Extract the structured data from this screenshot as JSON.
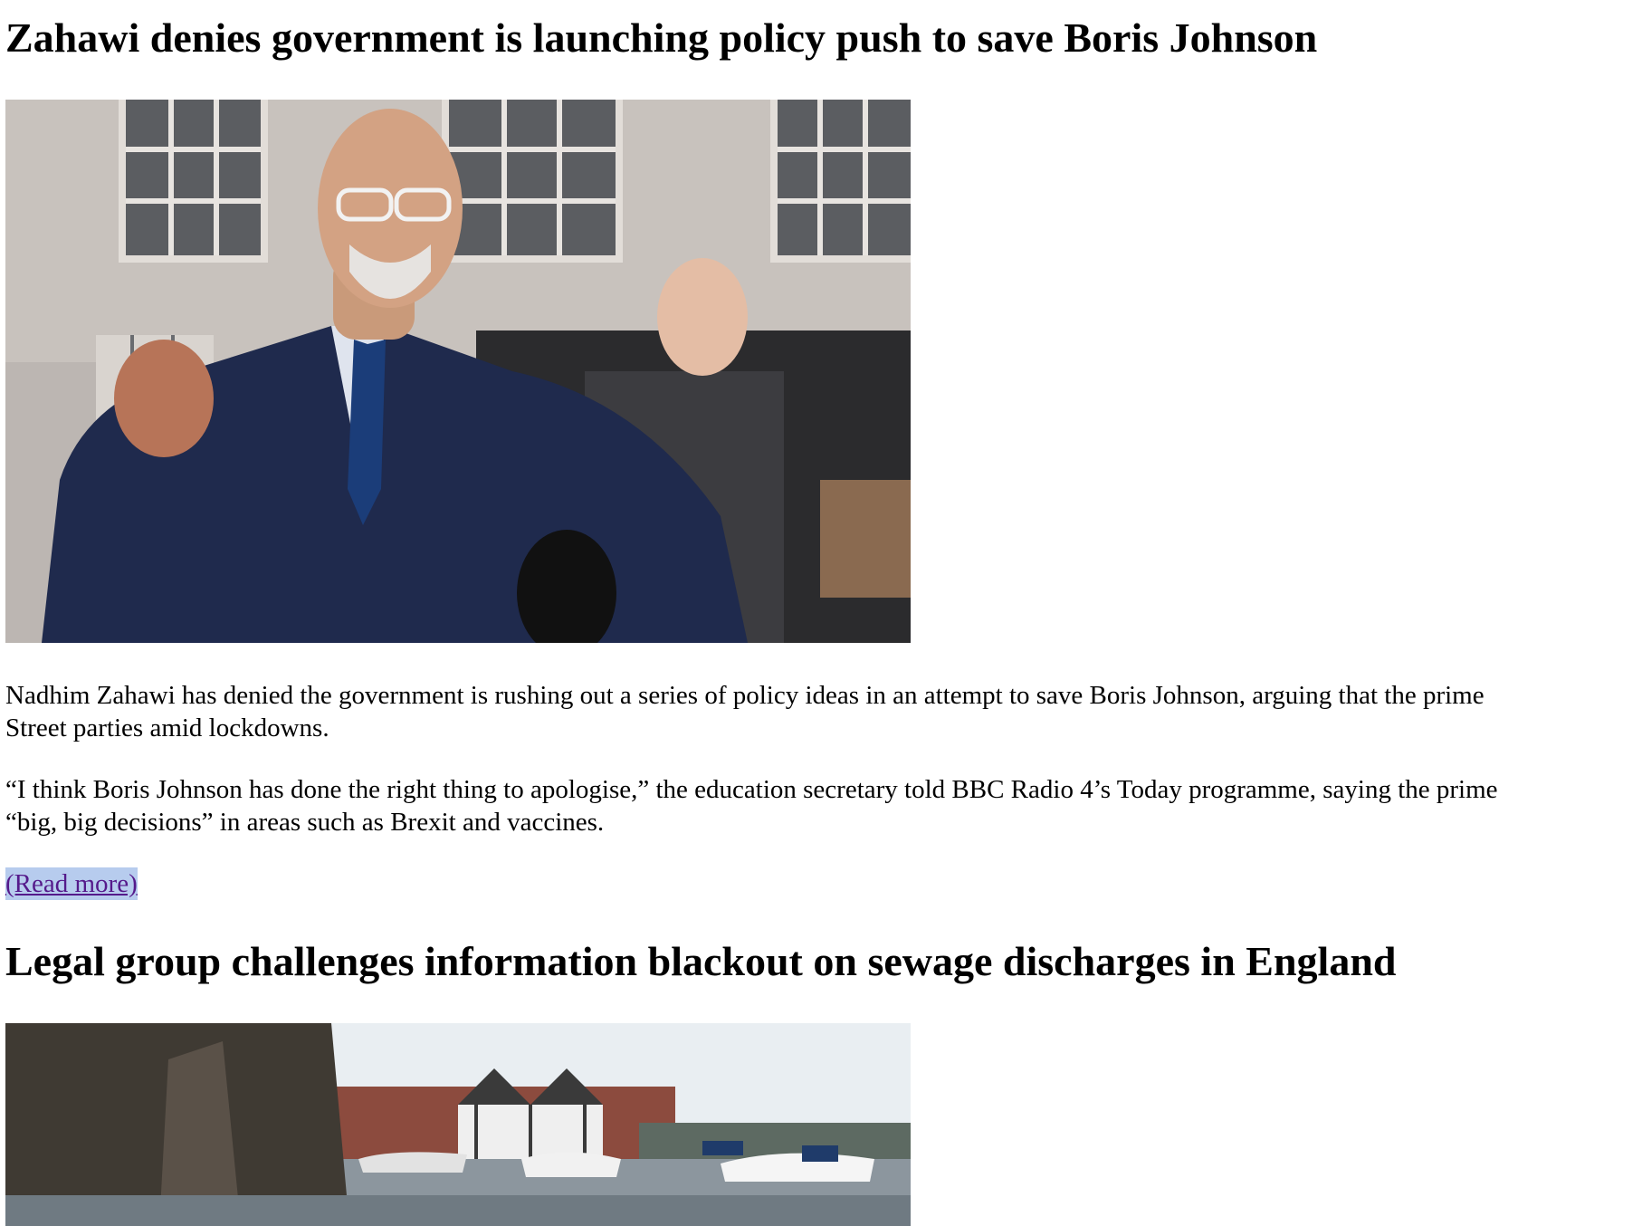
{
  "articles": [
    {
      "headline": "Zahawi denies government is launching policy push to save Boris Johnson",
      "para1_line1": "Nadhim Zahawi has denied the government is rushing out a series of policy ideas in an attempt to save Boris Johnson, arguing that the prime",
      "para1_line2": "Street parties amid lockdowns.",
      "para2_line1": "“I think Boris Johnson has done the right thing to apologise,” the education secretary told BBC Radio 4’s Today programme, saying the prime",
      "para2_line2": "“big, big decisions” in areas such as Brexit and vaccines.",
      "read_more": "(Read more)"
    },
    {
      "headline": "Legal group challenges information blackout on sewage discharges in England"
    }
  ],
  "colors": {
    "link": "#551a8b",
    "link_highlight": "#b7ccee"
  }
}
